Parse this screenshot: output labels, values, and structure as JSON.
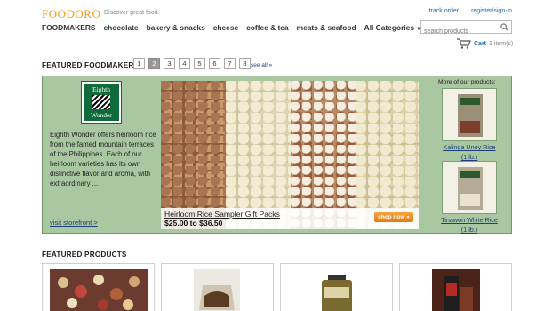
{
  "brand": {
    "logo": "FOODORO",
    "tagline": "Discover great food."
  },
  "top_links": [
    "track order",
    "register/sign-in"
  ],
  "nav": [
    "FOODMAKERS",
    "chocolate",
    "bakery & snacks",
    "cheese",
    "coffee & tea",
    "meats & seafood",
    "All Categories"
  ],
  "search": {
    "placeholder": "search products"
  },
  "cart": {
    "label": "Cart",
    "count": "3 item(s)"
  },
  "featured_foodmakers": {
    "title": "FEATURED FOODMAKERS",
    "pages": [
      "1",
      "2",
      "3",
      "4",
      "5",
      "6",
      "7",
      "8"
    ],
    "active_page": "2",
    "see_all": "see all »"
  },
  "maker": {
    "logo_top": "Eighth",
    "logo_bottom": "Wonder",
    "description": "Eighth Wonder offers heirloom rice from the famed mountain terraces of the Philippines. Each of our heirloom varieties has its own distinctive flavor and aroma, with extraordinary ...",
    "visit": "visit storefront >"
  },
  "spotlight": {
    "name": "Heirloom Rice Sampler Gift Packs",
    "price": "$25.00 to $36.50",
    "shop_now": "shop now »"
  },
  "more_products": {
    "title": "More of our products:",
    "items": [
      {
        "label": "Kalinga Unoy Rice",
        "size": "(1 lb.)"
      },
      {
        "label": "Tinawon White Rice",
        "size": "(1 lb.)"
      }
    ]
  },
  "featured_products": {
    "title": "FEATURED PRODUCTS"
  },
  "colors": {
    "brand_orange": "#f39a1d",
    "panel_green": "#a9c7a0",
    "link_blue": "#1f6aa5"
  }
}
